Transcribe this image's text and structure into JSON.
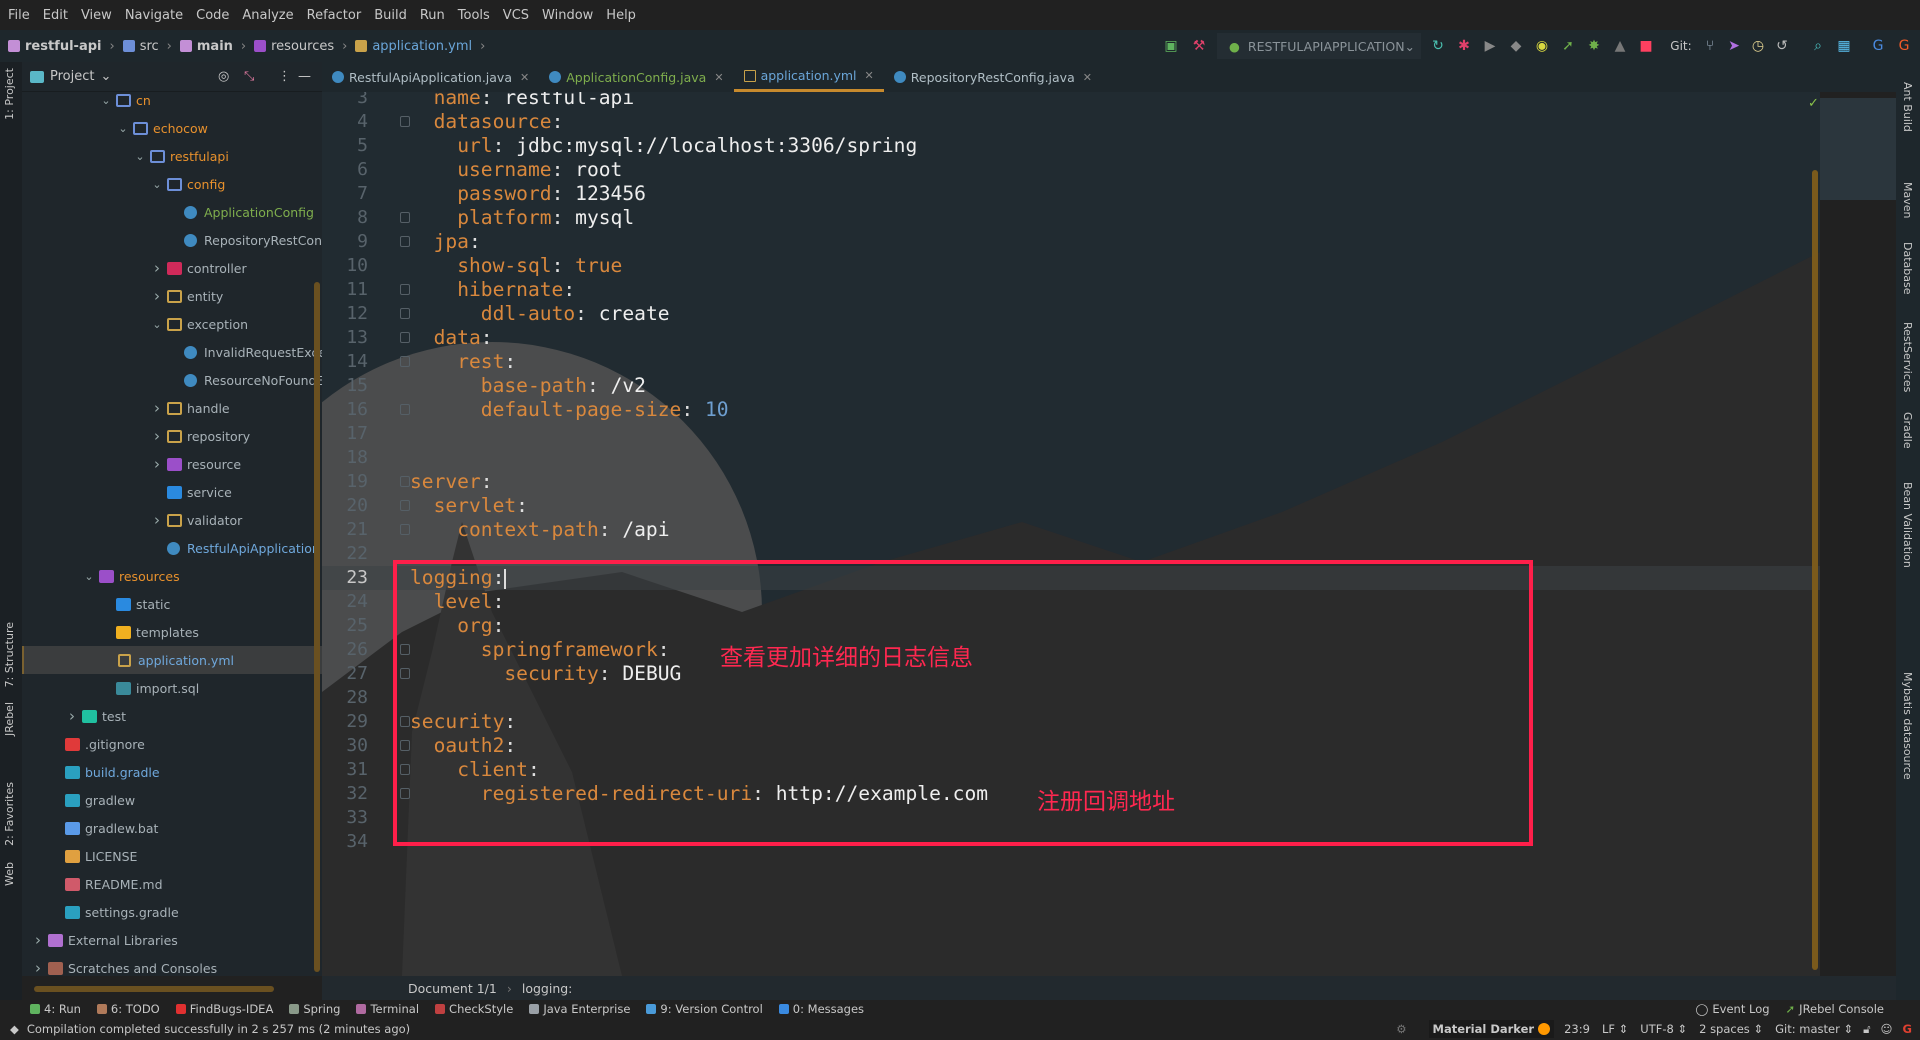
{
  "menu": [
    "File",
    "Edit",
    "View",
    "Navigate",
    "Code",
    "Analyze",
    "Refactor",
    "Build",
    "Run",
    "Tools",
    "VCS",
    "Window",
    "Help"
  ],
  "breadcrumb": [
    {
      "label": "restful-api",
      "color": "#c38fd6",
      "bold": true
    },
    {
      "label": "src",
      "color": "#6d8fd8"
    },
    {
      "label": "main",
      "color": "#c38fd6",
      "bold": true
    },
    {
      "label": "resources",
      "color": "#9b4fc9"
    },
    {
      "label": "application.yml",
      "color": "#c9a24a",
      "accent": true
    }
  ],
  "toolbar": {
    "run_config": "RESTFULAPIAPPLICATION",
    "git_label": "Git:"
  },
  "left_stripe": [
    "1: Project",
    "7: Structure",
    "JRebel",
    "2: Favorites",
    "Web"
  ],
  "right_stripe": [
    "Ant Build",
    "Maven",
    "Database",
    "RestServices",
    "Gradle",
    "Bean Validation",
    "Mybatis datasource"
  ],
  "project_panel": {
    "title": "Project",
    "tree": [
      {
        "label": "cn",
        "depth": 4,
        "arrow": "open",
        "icon": "folder",
        "color": "#e8912d"
      },
      {
        "label": "echocow",
        "depth": 5,
        "arrow": "open",
        "icon": "folder",
        "color": "#e8912d"
      },
      {
        "label": "restfulapi",
        "depth": 6,
        "arrow": "open",
        "icon": "folder",
        "color": "#e8912d"
      },
      {
        "label": "config",
        "depth": 7,
        "arrow": "open",
        "icon": "folder",
        "color": "#e8912d"
      },
      {
        "label": "ApplicationConfig",
        "depth": 8,
        "arrow": "none",
        "icon": "class",
        "color": "#7fae4d"
      },
      {
        "label": "RepositoryRestConfig",
        "depth": 8,
        "arrow": "none",
        "icon": "class",
        "color": "#a8b2b8"
      },
      {
        "label": "controller",
        "depth": 7,
        "arrow": "closed",
        "icon": "folder-controller",
        "color": "#a8b2b8"
      },
      {
        "label": "entity",
        "depth": 7,
        "arrow": "closed",
        "icon": "package",
        "color": "#a8b2b8"
      },
      {
        "label": "exception",
        "depth": 7,
        "arrow": "open",
        "icon": "package",
        "color": "#a8b2b8"
      },
      {
        "label": "InvalidRequestException",
        "depth": 8,
        "arrow": "none",
        "icon": "exception",
        "color": "#a8b2b8"
      },
      {
        "label": "ResourceNoFoundExcep",
        "depth": 8,
        "arrow": "none",
        "icon": "exception",
        "color": "#a8b2b8"
      },
      {
        "label": "handle",
        "depth": 7,
        "arrow": "closed",
        "icon": "package",
        "color": "#a8b2b8"
      },
      {
        "label": "repository",
        "depth": 7,
        "arrow": "closed",
        "icon": "package",
        "color": "#a8b2b8"
      },
      {
        "label": "resource",
        "depth": 7,
        "arrow": "closed",
        "icon": "folder-resource",
        "color": "#a8b2b8"
      },
      {
        "label": "service",
        "depth": 7,
        "arrow": "none",
        "icon": "folder-service",
        "color": "#a8b2b8"
      },
      {
        "label": "validator",
        "depth": 7,
        "arrow": "closed",
        "icon": "package",
        "color": "#a8b2b8"
      },
      {
        "label": "RestfulApiApplication",
        "depth": 7,
        "arrow": "none",
        "icon": "spring-boot-class",
        "color": "#6fa8dc"
      },
      {
        "label": "resources",
        "depth": 3,
        "arrow": "open",
        "icon": "folder-resource",
        "color": "#e8912d"
      },
      {
        "label": "static",
        "depth": 4,
        "arrow": "none",
        "icon": "folder-web",
        "color": "#a8b2b8"
      },
      {
        "label": "templates",
        "depth": 4,
        "arrow": "none",
        "icon": "folder-templates",
        "color": "#a8b2b8"
      },
      {
        "label": "application.yml",
        "depth": 4,
        "arrow": "none",
        "icon": "yaml",
        "color": "#6fa8dc",
        "selected": true
      },
      {
        "label": "import.sql",
        "depth": 4,
        "arrow": "none",
        "icon": "sql",
        "color": "#a8b2b8"
      },
      {
        "label": "test",
        "depth": 2,
        "arrow": "closed",
        "icon": "folder-test",
        "color": "#a8b2b8"
      },
      {
        "label": ".gitignore",
        "depth": 1,
        "arrow": "none",
        "icon": "git",
        "color": "#a8b2b8"
      },
      {
        "label": "build.gradle",
        "depth": 1,
        "arrow": "none",
        "icon": "gradle",
        "color": "#6fa8dc"
      },
      {
        "label": "gradlew",
        "depth": 1,
        "arrow": "none",
        "icon": "gradle",
        "color": "#a8b2b8"
      },
      {
        "label": "gradlew.bat",
        "depth": 1,
        "arrow": "none",
        "icon": "windows",
        "color": "#a8b2b8"
      },
      {
        "label": "LICENSE",
        "depth": 1,
        "arrow": "none",
        "icon": "license",
        "color": "#a8b2b8"
      },
      {
        "label": "README.md",
        "depth": 1,
        "arrow": "none",
        "icon": "markdown",
        "color": "#a8b2b8"
      },
      {
        "label": "settings.gradle",
        "depth": 1,
        "arrow": "none",
        "icon": "gradle",
        "color": "#a8b2b8"
      },
      {
        "label": "External Libraries",
        "depth": 0,
        "arrow": "closed",
        "icon": "library",
        "color": "#a8b2b8"
      },
      {
        "label": "Scratches and Consoles",
        "depth": 0,
        "arrow": "closed",
        "icon": "scratches",
        "color": "#a8b2b8"
      }
    ]
  },
  "tabs": [
    {
      "label": "RestfulApiApplication.java",
      "color": "#b0bec5",
      "icon": "spring-boot-class"
    },
    {
      "label": "ApplicationConfig.java",
      "color": "#7fae4d",
      "icon": "class"
    },
    {
      "label": "application.yml",
      "color": "#6aa5d8",
      "icon": "yaml",
      "active": true
    },
    {
      "label": "RepositoryRestConfig.java",
      "color": "#b0bec5",
      "icon": "class"
    }
  ],
  "editor": {
    "current_line": 23,
    "lines": [
      {
        "n": 3,
        "indent": 1,
        "key": "name",
        "value": "restful-api"
      },
      {
        "n": 4,
        "indent": 1,
        "key": "datasource",
        "fold": true
      },
      {
        "n": 5,
        "indent": 2,
        "key": "url",
        "value": "jdbc:mysql://localhost:3306/spring"
      },
      {
        "n": 6,
        "indent": 2,
        "key": "username",
        "value": "root"
      },
      {
        "n": 7,
        "indent": 2,
        "key": "password",
        "value": "123456"
      },
      {
        "n": 8,
        "indent": 2,
        "key": "platform",
        "value": "mysql",
        "fold": true
      },
      {
        "n": 9,
        "indent": 1,
        "key": "jpa",
        "fold": true
      },
      {
        "n": 10,
        "indent": 2,
        "key": "show-sql",
        "value": "true",
        "type": "bool"
      },
      {
        "n": 11,
        "indent": 2,
        "key": "hibernate",
        "fold": true
      },
      {
        "n": 12,
        "indent": 3,
        "key": "ddl-auto",
        "value": "create",
        "fold": true
      },
      {
        "n": 13,
        "indent": 1,
        "key": "data",
        "fold": true
      },
      {
        "n": 14,
        "indent": 2,
        "key": "rest",
        "fold": true
      },
      {
        "n": 15,
        "indent": 3,
        "key": "base-path",
        "value": "/v2"
      },
      {
        "n": 16,
        "indent": 3,
        "key": "default-page-size",
        "value": "10",
        "type": "number",
        "fold": true
      },
      {
        "n": 17
      },
      {
        "n": 18
      },
      {
        "n": 19,
        "indent": 0,
        "key": "server",
        "fold": true
      },
      {
        "n": 20,
        "indent": 1,
        "key": "servlet",
        "fold": true
      },
      {
        "n": 21,
        "indent": 2,
        "key": "context-path",
        "value": "/api",
        "fold": true
      },
      {
        "n": 22
      },
      {
        "n": 23,
        "indent": 0,
        "key": "logging",
        "cursor": true
      },
      {
        "n": 24,
        "indent": 1,
        "key": "level"
      },
      {
        "n": 25,
        "indent": 2,
        "key": "org"
      },
      {
        "n": 26,
        "indent": 3,
        "key": "springframework",
        "fold": true
      },
      {
        "n": 27,
        "indent": 4,
        "key": "security",
        "value": "DEBUG",
        "fold": true
      },
      {
        "n": 28
      },
      {
        "n": 29,
        "indent": 0,
        "key": "security",
        "fold": true
      },
      {
        "n": 30,
        "indent": 1,
        "key": "oauth2",
        "fold": true
      },
      {
        "n": 31,
        "indent": 2,
        "key": "client",
        "fold": true
      },
      {
        "n": 32,
        "indent": 3,
        "key": "registered-redirect-uri",
        "value": "http://example.com",
        "fold": true
      },
      {
        "n": 33
      },
      {
        "n": 34
      }
    ],
    "annotations": {
      "logging_note": "查看更加详细的日志信息",
      "redirect_note": "注册回调地址"
    },
    "highlight_color": "#ff1f4a"
  },
  "editor_breadcrumb": [
    "Document 1/1",
    "logging:"
  ],
  "tool_windows": [
    {
      "label": "4: Run",
      "color": "#5fb35f"
    },
    {
      "label": "6: TODO",
      "color": "#b07a5a"
    },
    {
      "label": "FindBugs-IDEA",
      "color": "#e03030"
    },
    {
      "label": "Spring",
      "color": "#8a9a8a"
    },
    {
      "label": "Terminal",
      "color": "#b06aa0"
    },
    {
      "label": "CheckStyle",
      "color": "#c04040"
    },
    {
      "label": "Java Enterprise",
      "color": "#9aa0a6"
    },
    {
      "label": "9: Version Control",
      "color": "#4a9ad8"
    },
    {
      "label": "0: Messages",
      "color": "#3a8ae0"
    }
  ],
  "tool_windows_right": [
    {
      "label": "Event Log"
    },
    {
      "label": "JRebel Console"
    }
  ],
  "status": {
    "message": "Compilation completed successfully in 2 s 257 ms (2 minutes ago)",
    "theme": "Material Darker",
    "theme_color": "#ff9800",
    "position": "23:9",
    "line_sep": "LF",
    "encoding": "UTF-8",
    "indent": "2 spaces",
    "git": "Git: master"
  }
}
